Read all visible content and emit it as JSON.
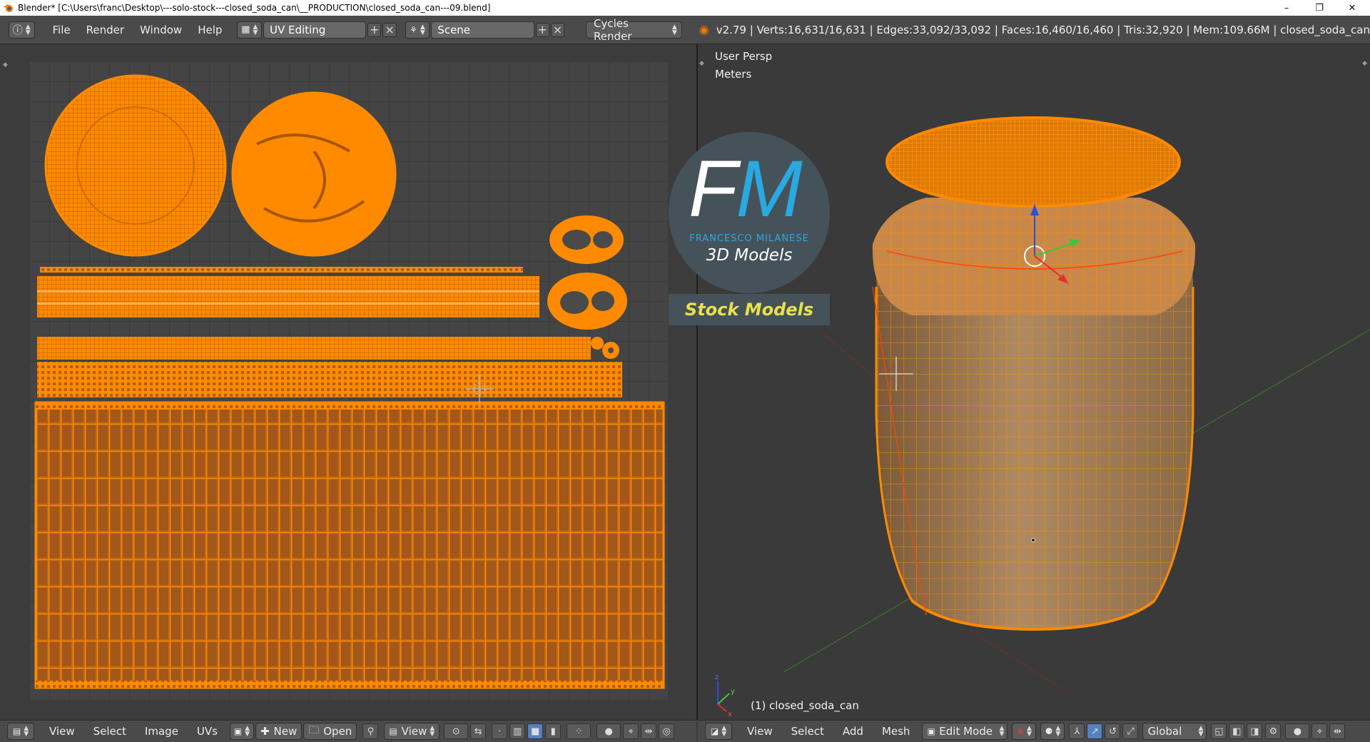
{
  "window": {
    "title": "Blender* [C:\\Users\\franc\\Desktop\\---solo-stock---closed_soda_can\\__PRODUCTION\\closed_soda_can---09.blend]",
    "min_glyph": "–",
    "max_glyph": "❐",
    "close_glyph": "✕"
  },
  "topbar": {
    "menus": [
      "File",
      "Render",
      "Window",
      "Help"
    ],
    "layout": "UV Editing",
    "scene": "Scene",
    "engine": "Cycles Render",
    "stats": "v2.79 | Verts:16,631/16,631 | Edges:33,092/33,092 | Faces:16,460/16,460 | Tris:32,920 | Mem:109.66M | closed_soda_can"
  },
  "uv_editor": {
    "menus": [
      "View",
      "Select",
      "Image",
      "UVs"
    ],
    "new_label": "New",
    "open_label": "Open",
    "view_label": "View"
  },
  "viewport": {
    "view_name": "User Persp",
    "units": "Meters",
    "object_label": "(1) closed_soda_can",
    "menus": [
      "View",
      "Select",
      "Add",
      "Mesh"
    ],
    "mode": "Edit Mode",
    "orientation": "Global"
  },
  "watermark": {
    "letter_f": "F",
    "letter_m": "M",
    "author": "FRANCESCO MILANESE",
    "subtitle": "3D Models",
    "banner": "Stock Models"
  },
  "colors": {
    "mesh": "#ff8a00",
    "accent_blue": "#29a9e1",
    "banner_yellow": "#e8e24a"
  }
}
